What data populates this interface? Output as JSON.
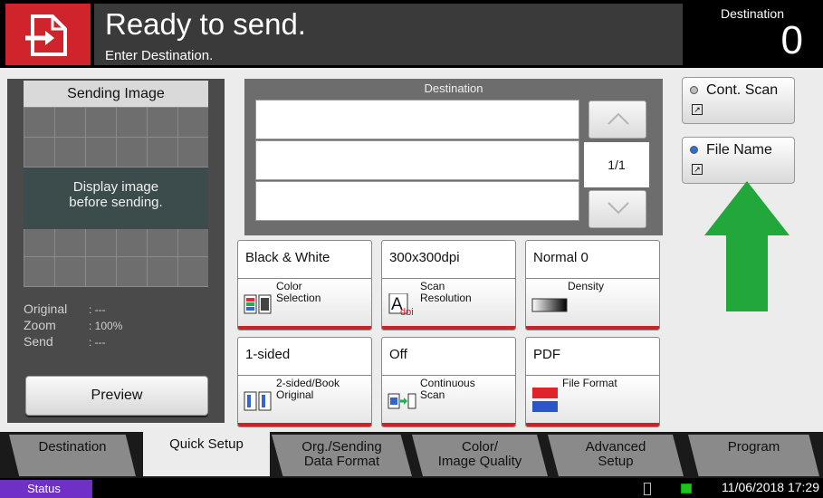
{
  "header": {
    "title": "Ready to send.",
    "subtitle": "Enter Destination.",
    "dest_label": "Destination",
    "dest_count": "0"
  },
  "preview": {
    "heading": "Sending Image",
    "message_line1": "Display image",
    "message_line2": "before sending.",
    "info": [
      {
        "label": "Original",
        "value": ": ---"
      },
      {
        "label": "Zoom",
        "value": ": 100%"
      },
      {
        "label": "Send",
        "value": ": ---"
      }
    ],
    "button": "Preview"
  },
  "destination": {
    "heading": "Destination",
    "page": "1/1"
  },
  "tiles": [
    {
      "value": "Black & White",
      "label_line1": "Color",
      "label_line2": "Selection",
      "icon": "color-selection-icon"
    },
    {
      "value": "300x300dpi",
      "label_line1": "Scan",
      "label_line2": "Resolution",
      "icon": "scan-resolution-icon"
    },
    {
      "value": "Normal 0",
      "label_line1": "Density",
      "label_line2": "",
      "icon": "density-icon"
    },
    {
      "value": "1-sided",
      "label_line1": "2-sided/Book",
      "label_line2": "Original",
      "icon": "two-sided-icon"
    },
    {
      "value": "Off",
      "label_line1": "Continuous",
      "label_line2": "Scan",
      "icon": "continuous-scan-icon"
    },
    {
      "value": "PDF",
      "label_line1": "File Format",
      "label_line2": "",
      "icon": "file-format-icon"
    }
  ],
  "side": {
    "cont_scan": "Cont. Scan",
    "file_name": "File Name"
  },
  "tabs": [
    {
      "line1": "Destination",
      "line2": ""
    },
    {
      "line1": "Quick Setup",
      "line2": ""
    },
    {
      "line1": "Org./Sending",
      "line2": "Data Format"
    },
    {
      "line1": "Color/",
      "line2": "Image Quality"
    },
    {
      "line1": "Advanced",
      "line2": "Setup"
    },
    {
      "line1": "Program",
      "line2": ""
    }
  ],
  "status": {
    "button": "Status",
    "datetime": "11/06/2018  17:29"
  },
  "colors": {
    "accent_red": "#d0242c",
    "arrow_green": "#22a83a",
    "status_purple": "#7030c8",
    "led_blue": "#2a6fe0"
  }
}
